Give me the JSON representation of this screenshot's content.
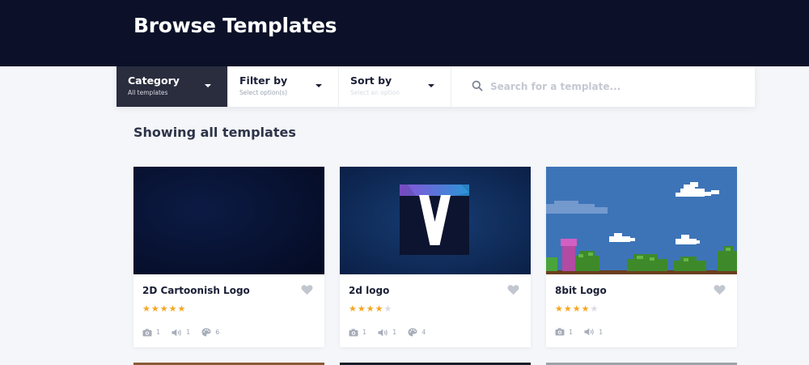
{
  "header": {
    "title": "Browse Templates"
  },
  "filters": [
    {
      "label": "Category",
      "sub": "All templates"
    },
    {
      "label": "Filter by",
      "sub": "Select option(s)"
    },
    {
      "label": "Sort by",
      "sub": "Select an option"
    }
  ],
  "search": {
    "placeholder": "Search for a template..."
  },
  "section": {
    "heading": "Showing all templates"
  },
  "cards": [
    {
      "title": "2D Cartoonish Logo",
      "rating": 5,
      "photos": "1",
      "audio": "1",
      "colors": "6"
    },
    {
      "title": "2d logo",
      "rating": 4,
      "photos": "1",
      "audio": "1",
      "colors": "4"
    },
    {
      "title": "8bit Logo",
      "rating": 4,
      "photos": "1",
      "audio": "1"
    }
  ],
  "icons": {
    "search": "search-icon",
    "caret": "caret-down-icon",
    "favorite": "heart-icon",
    "photos": "camera-icon",
    "audio": "speaker-icon",
    "colors": "palette-icon",
    "star": "star-icon"
  },
  "colors": {
    "header_bg": "#0c1129",
    "active_filter_bg": "#2a2d3e",
    "star": "#f5a623",
    "page_bg": "#f4f6f9"
  }
}
